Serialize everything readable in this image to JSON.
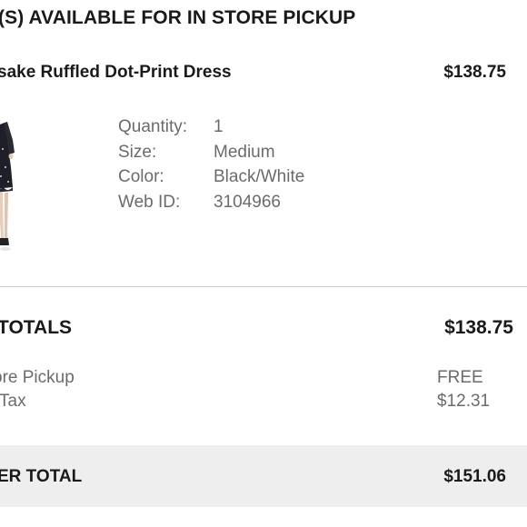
{
  "pickup_section": {
    "header": "(S) AVAILABLE FOR IN STORE PICKUP"
  },
  "item": {
    "name": "sake Ruffled Dot-Print Dress",
    "price": "$138.75",
    "image_icon": "dress-product-image",
    "details": [
      {
        "label": "Quantity:",
        "value": "1"
      },
      {
        "label": "Size:",
        "value": "Medium"
      },
      {
        "label": "Color:",
        "value": "Black/White"
      },
      {
        "label": "Web ID:",
        "value": "3104966"
      }
    ]
  },
  "totals": {
    "title": "TOTALS",
    "amount": "$138.75",
    "lines": [
      {
        "label": "ore Pickup",
        "value": "FREE"
      },
      {
        "label": "Tax",
        "value": "$12.31"
      }
    ]
  },
  "order_total": {
    "label": "ER TOTAL",
    "value": "$151.06"
  },
  "colors": {
    "text": "#1a1a1a",
    "muted": "#6b6b6b",
    "band": "#eeeeee",
    "divider": "#cfcfcf"
  }
}
